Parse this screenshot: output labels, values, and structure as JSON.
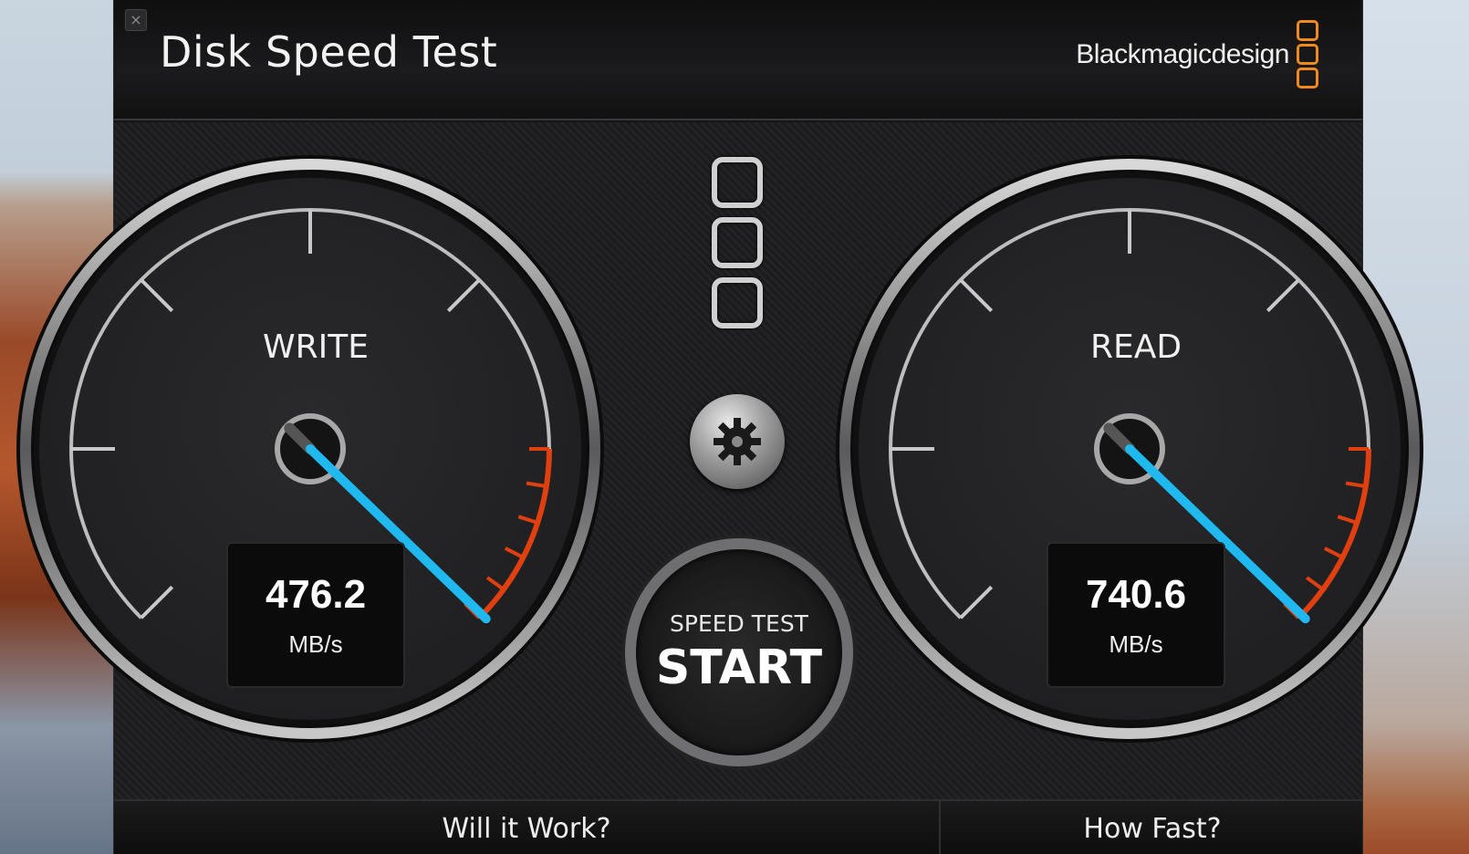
{
  "window": {
    "title": "Disk Speed Test",
    "brand": "Blackmagicdesign",
    "close_icon": "close-icon"
  },
  "gauges": {
    "write": {
      "label": "WRITE",
      "value": "476.2",
      "unit": "MB/s"
    },
    "read": {
      "label": "READ",
      "value": "740.6",
      "unit": "MB/s"
    }
  },
  "controls": {
    "settings_icon": "gear-icon",
    "start_sub": "SPEED TEST",
    "start_main": "START"
  },
  "footer": {
    "left_tab": "Will it Work?",
    "right_tab": "How Fast?"
  },
  "colors": {
    "needle": "#1fb8ef",
    "redline": "#e04010",
    "brand_orange": "#f08a1c",
    "bezel": "#9a9a9c"
  }
}
